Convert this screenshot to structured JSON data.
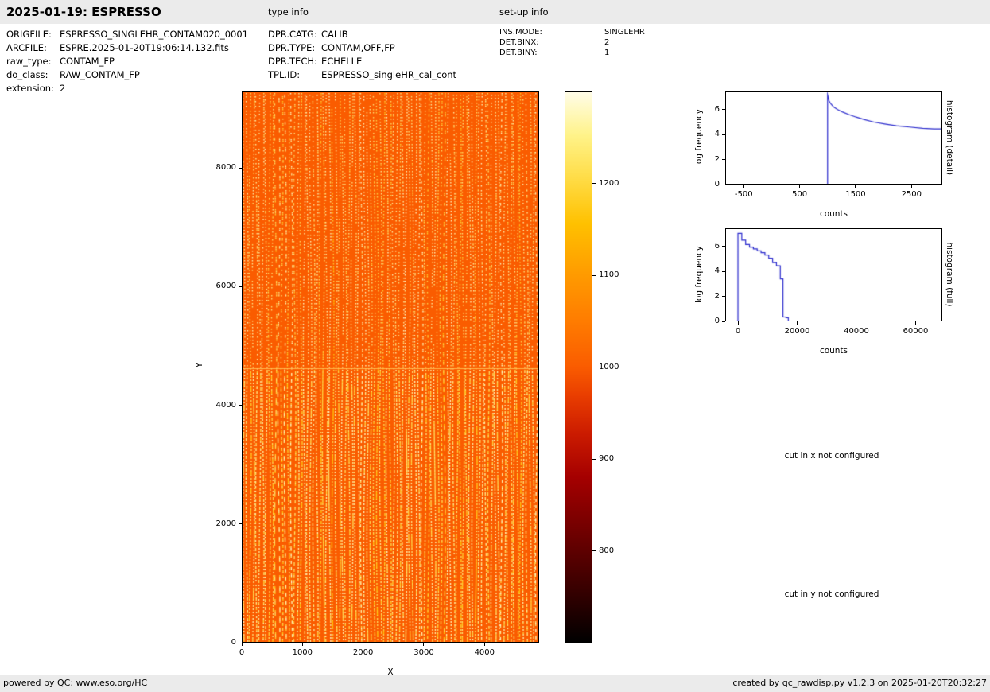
{
  "header": {
    "title": "2025-01-19: ESPRESSO",
    "type_info_label": "type info",
    "setup_info_label": "set-up info"
  },
  "file_info": {
    "rows": [
      {
        "label": "ORIGFILE:",
        "value": "ESPRESSO_SINGLEHR_CONTAM020_0001"
      },
      {
        "label": "ARCFILE:",
        "value": "ESPRE.2025-01-20T19:06:14.132.fits"
      },
      {
        "label": "raw_type:",
        "value": "CONTAM_FP"
      },
      {
        "label": "do_class:",
        "value": "RAW_CONTAM_FP"
      },
      {
        "label": "extension:",
        "value": "2"
      }
    ]
  },
  "type_info": {
    "rows": [
      {
        "label": "DPR.CATG:",
        "value": "CALIB"
      },
      {
        "label": "DPR.TYPE:",
        "value": "CONTAM,OFF,FP"
      },
      {
        "label": "DPR.TECH:",
        "value": "ECHELLE"
      },
      {
        "label": "TPL.ID:",
        "value": "ESPRESSO_singleHR_cal_cont"
      }
    ]
  },
  "setup_info": {
    "rows": [
      {
        "label": "INS.MODE:",
        "value": "SINGLEHR"
      },
      {
        "label": "DET.BINX:",
        "value": "2"
      },
      {
        "label": "DET.BINY:",
        "value": "1"
      }
    ]
  },
  "messages": {
    "cut_x": "cut in x not configured",
    "cut_y": "cut in y not configured"
  },
  "footer": {
    "left": "powered by QC: www.eso.org/HC",
    "right": "created by qc_rawdisp.py v1.2.3 on 2025-01-20T20:32:27"
  },
  "colors": {
    "line_blue": "#2929cc",
    "image_base": "#fa5c00",
    "bar_bg": "#ebebeb"
  },
  "chart_data": [
    {
      "id": "detector-image",
      "type": "heatmap",
      "xlabel": "X",
      "ylabel": "Y",
      "xlim": [
        0,
        4900
      ],
      "ylim": [
        0,
        9290
      ],
      "xticks": [
        0,
        1000,
        2000,
        3000,
        4000
      ],
      "yticks": [
        0,
        2000,
        4000,
        6000,
        8000
      ],
      "description": "raw echelle FP contamination frame: uniform ~1000-count orange background with dense vertical dotted emission-line orders, brighter continuous streaks in the lower half and a faint horizontal detector-gap line near y=4650",
      "colorbar": {
        "vmin": 700,
        "vmax": 1300,
        "ticks": [
          800,
          900,
          1000,
          1100,
          1200
        ],
        "colormap": "hot"
      }
    },
    {
      "id": "histogram-detail",
      "type": "line",
      "xlabel": "counts",
      "ylabel": "log frequency",
      "side_label": "histogram (detail)",
      "xlim": [
        -830,
        3050
      ],
      "ylim": [
        0,
        7.45
      ],
      "xticks": [
        -500,
        500,
        1500,
        2500
      ],
      "yticks": [
        0,
        2,
        4,
        6
      ],
      "x": [
        1000,
        1000,
        1025,
        1060,
        1110,
        1180,
        1270,
        1380,
        1510,
        1660,
        1830,
        2020,
        2230,
        2460,
        2700,
        2900,
        3040,
        3050
      ],
      "y": [
        0,
        7.2,
        6.7,
        6.45,
        6.2,
        6.0,
        5.8,
        5.6,
        5.4,
        5.2,
        5.0,
        4.85,
        4.7,
        4.6,
        4.5,
        4.45,
        4.45,
        5.75
      ]
    },
    {
      "id": "histogram-full",
      "type": "step",
      "xlabel": "counts",
      "ylabel": "log frequency",
      "side_label": "histogram (full)",
      "xlim": [
        -4300,
        69000
      ],
      "ylim": [
        0,
        7.45
      ],
      "xticks": [
        0,
        20000,
        40000,
        60000
      ],
      "yticks": [
        0,
        2,
        4,
        6
      ],
      "x": [
        -400,
        0,
        1300,
        2600,
        3900,
        5200,
        6500,
        7800,
        9100,
        10400,
        11700,
        13000,
        14300,
        15200,
        16200,
        17000
      ],
      "y": [
        0,
        7.05,
        6.5,
        6.15,
        5.95,
        5.8,
        5.65,
        5.5,
        5.3,
        5.05,
        4.7,
        4.45,
        3.4,
        0.35,
        0.3,
        0
      ]
    }
  ]
}
